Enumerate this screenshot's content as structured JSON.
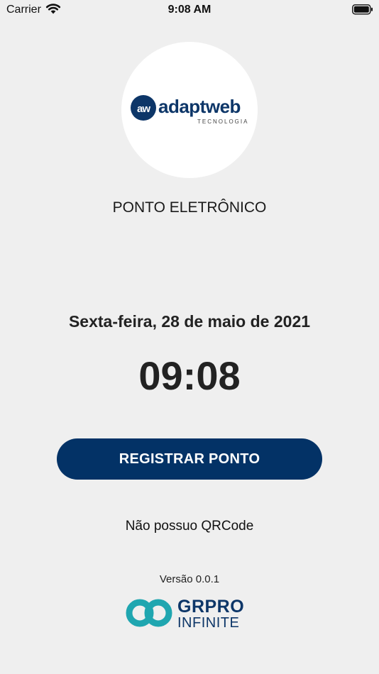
{
  "status_bar": {
    "carrier": "Carrier",
    "time": "9:08 AM",
    "wifi_icon": "wifi-icon",
    "battery_icon": "battery-icon"
  },
  "logo": {
    "mark": "aw",
    "brand": "adaptweb",
    "tagline": "TECNOLOGIA"
  },
  "app_title": "PONTO ELETRÔNICO",
  "date": "Sexta-feira, 28 de maio de 2021",
  "time": "09:08",
  "register_button_label": "REGISTRAR PONTO",
  "no_qrcode_label": "Não possuo QRCode",
  "version": "Versão 0.0.1",
  "footer_logo": {
    "name": "GRPRO",
    "sub": "INFINITE"
  },
  "colors": {
    "primary": "#033266",
    "brand_teal": "#1fa6b0",
    "background": "#efefef"
  }
}
